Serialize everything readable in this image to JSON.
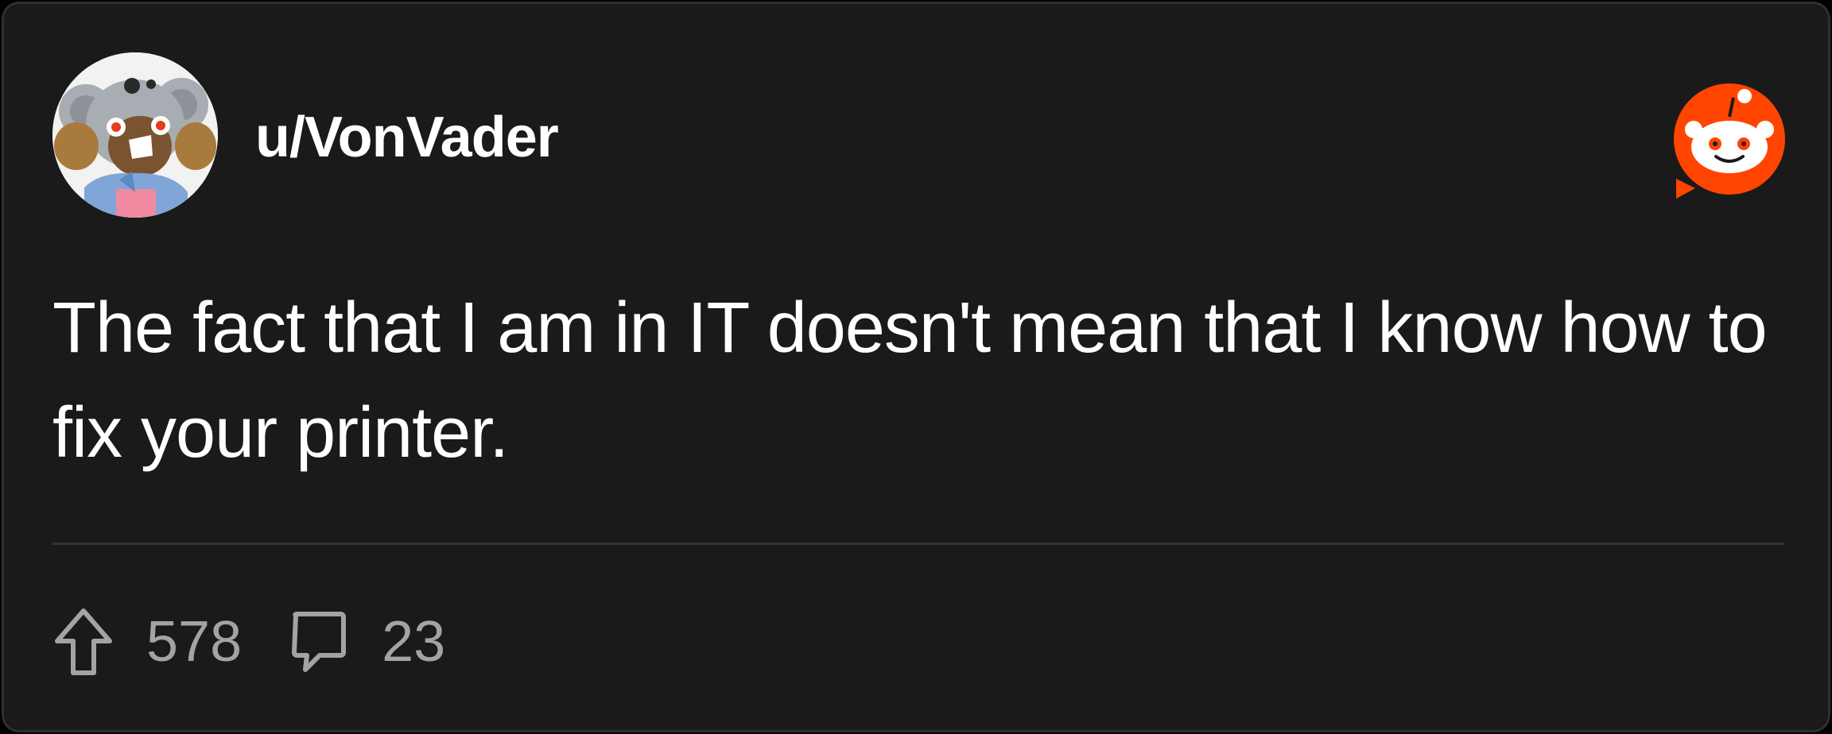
{
  "post": {
    "username": "u/VonVader",
    "text": "The fact that I am in IT doesn't mean that I know how to fix your printer."
  },
  "stats": {
    "upvotes": "578",
    "comments": "23"
  },
  "icons": {
    "avatar": "koala-avatar",
    "brand": "reddit-logo-icon",
    "upvote": "upvote-arrow-icon",
    "comment": "comment-bubble-icon"
  },
  "colors": {
    "background": "#1a1a1b",
    "text": "#ffffff",
    "muted": "#a3a3a3",
    "reddit_orange": "#ff4500",
    "divider": "#343536"
  }
}
